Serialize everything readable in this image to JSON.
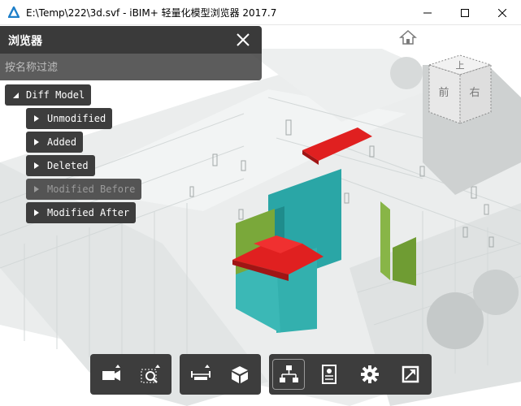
{
  "window": {
    "title": "E:\\Temp\\222\\3d.svf - iBIM+ 轻量化模型浏览器 2017.7",
    "minimize_icon": "minimize-icon",
    "maximize_icon": "maximize-icon",
    "close_icon": "close-icon"
  },
  "browser": {
    "title": "浏览器",
    "filter_placeholder": "按名称过滤",
    "tree": [
      {
        "label": "Diff Model",
        "expanded": true,
        "enabled": true
      },
      {
        "label": "Unmodified",
        "expanded": false,
        "enabled": true
      },
      {
        "label": "Added",
        "expanded": false,
        "enabled": true
      },
      {
        "label": "Deleted",
        "expanded": false,
        "enabled": true
      },
      {
        "label": "Modified Before",
        "expanded": false,
        "enabled": false
      },
      {
        "label": "Modified After",
        "expanded": false,
        "enabled": true
      }
    ]
  },
  "viewcube": {
    "top": "上",
    "front": "前",
    "right": "右"
  },
  "toolbar": {
    "groups": [
      [
        "camera-icon",
        "zoom-window-icon"
      ],
      [
        "measure-icon",
        "section-box-icon"
      ],
      [
        "model-tree-icon",
        "properties-icon",
        "settings-icon",
        "fullscreen-icon"
      ]
    ],
    "active": "model-tree-icon"
  },
  "colors": {
    "added": "#e02020",
    "deleted": "#2aa6a6",
    "modified": "#7aa83a",
    "panel": "#3d3d3d",
    "accent": "#1e7fc9"
  }
}
